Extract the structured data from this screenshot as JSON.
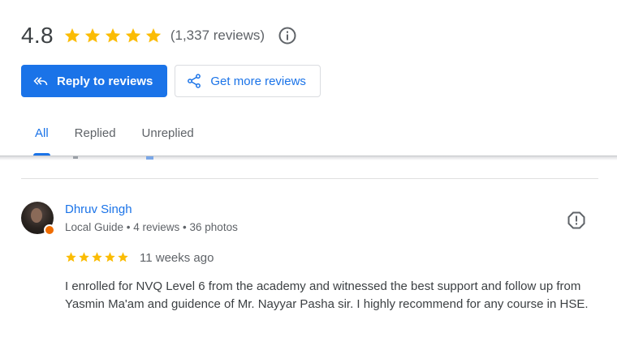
{
  "summary": {
    "rating": "4.8",
    "stars_filled": 5,
    "review_count": "(1,337 reviews)"
  },
  "actions": {
    "reply_label": "Reply to reviews",
    "get_more_label": "Get more reviews"
  },
  "tabs": [
    {
      "label": "All",
      "active": true
    },
    {
      "label": "Replied",
      "active": false
    },
    {
      "label": "Unreplied",
      "active": false
    }
  ],
  "review": {
    "name": "Dhruv Singh",
    "meta": "Local Guide • 4 reviews • 36 photos",
    "stars": 5,
    "time": "11 weeks ago",
    "text": "I enrolled for NVQ Level 6 from the academy and witnessed the best support and follow up from Yasmin Ma'am and guidence of Mr. Nayyar Pasha sir. I highly recommend for any course in HSE."
  },
  "colors": {
    "accent": "#1a73e8",
    "star": "#fbbc04",
    "text": "#3c4043",
    "muted": "#5f6368",
    "badge": "#ef6c00"
  },
  "icons": {
    "info": "info-icon",
    "reply": "reply-icon",
    "share": "share-icon",
    "flag": "report-icon"
  }
}
